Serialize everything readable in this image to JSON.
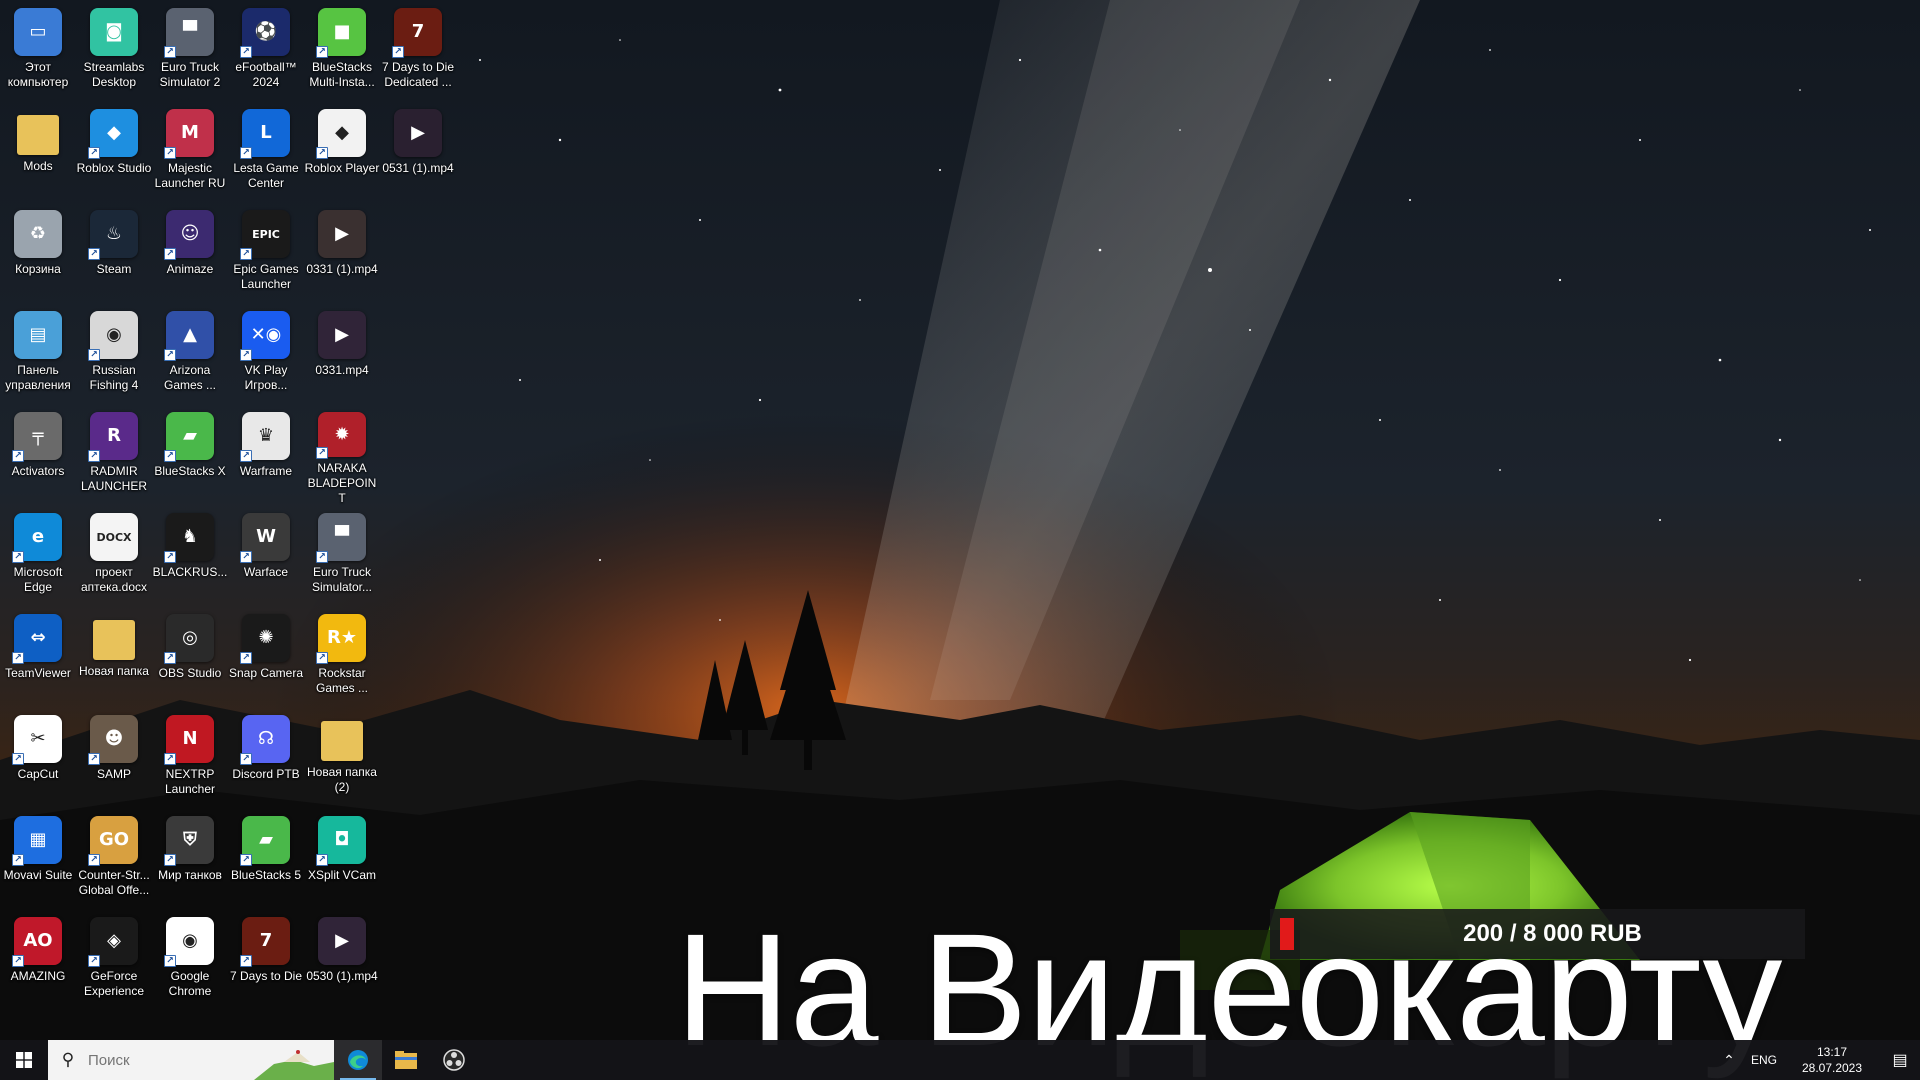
{
  "desktop": {
    "icons": [
      {
        "label": "Этот компьютер",
        "icon": "this-pc-icon",
        "bg": "#3a7bd5",
        "glyph": "▭",
        "shortcut": false
      },
      {
        "label": "Streamlabs Desktop",
        "icon": "streamlabs-icon",
        "bg": "#31c3a2",
        "glyph": "◙",
        "shortcut": false
      },
      {
        "label": "Euro Truck Simulator 2",
        "icon": "euro-truck-icon",
        "bg": "#5a6270",
        "glyph": "▀",
        "shortcut": true
      },
      {
        "label": "eFootball™ 2024",
        "icon": "efootball-icon",
        "bg": "#1b2a6b",
        "glyph": "⚽",
        "shortcut": true
      },
      {
        "label": "BlueStacks Multi-Insta...",
        "icon": "bluestacks-multi-icon",
        "bg": "#57c442",
        "glyph": "■",
        "shortcut": true
      },
      {
        "label": "7 Days to Die Dedicated ...",
        "icon": "7days-dedicated-icon",
        "bg": "#6b1d12",
        "glyph": "7",
        "shortcut": true
      },
      {
        "label": "Mods",
        "icon": "folder-icon",
        "bg": "#e8c25a",
        "glyph": "",
        "shortcut": false
      },
      {
        "label": "Roblox Studio",
        "icon": "roblox-studio-icon",
        "bg": "#1e8fe0",
        "glyph": "◆",
        "shortcut": true
      },
      {
        "label": "Majestic Launcher RU",
        "icon": "majestic-icon",
        "bg": "#c0304a",
        "glyph": "M",
        "shortcut": true
      },
      {
        "label": "Lesta Game Center",
        "icon": "lesta-icon",
        "bg": "#1168d8",
        "glyph": "L",
        "shortcut": true
      },
      {
        "label": "Roblox Player",
        "icon": "roblox-player-icon",
        "bg": "#f2f2f2",
        "glyph": "◆",
        "shortcut": true
      },
      {
        "label": "0531 (1).mp4",
        "icon": "video-file-icon",
        "bg": "#2a2030",
        "glyph": "▶",
        "shortcut": false
      },
      {
        "label": "Корзина",
        "icon": "recycle-bin-icon",
        "bg": "#9aa4ae",
        "glyph": "♻",
        "shortcut": false
      },
      {
        "label": "Steam",
        "icon": "steam-icon",
        "bg": "#1b2838",
        "glyph": "♨",
        "shortcut": true
      },
      {
        "label": "Animaze",
        "icon": "animaze-icon",
        "bg": "#3c2a70",
        "glyph": "☺",
        "shortcut": true
      },
      {
        "label": "Epic Games Launcher",
        "icon": "epic-games-icon",
        "bg": "#1a1a1a",
        "glyph": "EPIC",
        "shortcut": true
      },
      {
        "label": "0331 (1).mp4",
        "icon": "video-file-icon",
        "bg": "#3a3030",
        "glyph": "▶",
        "shortcut": false
      },
      {
        "label": "Панель управления",
        "icon": "control-panel-icon",
        "bg": "#4aa0d8",
        "glyph": "▤",
        "shortcut": false
      },
      {
        "label": "Russian Fishing 4",
        "icon": "russian-fishing-icon",
        "bg": "#d8d8d8",
        "glyph": "◉",
        "shortcut": true
      },
      {
        "label": "Arizona Games ...",
        "icon": "arizona-icon",
        "bg": "#3050a8",
        "glyph": "▲",
        "shortcut": true
      },
      {
        "label": "VK Play Игров...",
        "icon": "vk-play-icon",
        "bg": "#1a5cf0",
        "glyph": "✕◉",
        "shortcut": true
      },
      {
        "label": "0331.mp4",
        "icon": "video-file-icon",
        "bg": "#302438",
        "glyph": "▶",
        "shortcut": false
      },
      {
        "label": "Activators",
        "icon": "activators-icon",
        "bg": "#6a6a6a",
        "glyph": "╤",
        "shortcut": true
      },
      {
        "label": "RADMIR LAUNCHER",
        "icon": "radmir-icon",
        "bg": "#5a2a8a",
        "glyph": "R",
        "shortcut": true
      },
      {
        "label": "BlueStacks X",
        "icon": "bluestacks-x-icon",
        "bg": "#4ab84a",
        "glyph": "▰",
        "shortcut": true
      },
      {
        "label": "Warframe",
        "icon": "warframe-icon",
        "bg": "#e8e8e8",
        "glyph": "♛",
        "shortcut": true
      },
      {
        "label": "NARAKA BLADEPOINT",
        "icon": "naraka-icon",
        "bg": "#b0202a",
        "glyph": "✹",
        "shortcut": true
      },
      {
        "label": "Microsoft Edge",
        "icon": "edge-icon",
        "bg": "#0f8ad8",
        "glyph": "e",
        "shortcut": true
      },
      {
        "label": "проект аптека.docx",
        "icon": "docx-file-icon",
        "bg": "#f4f4f4",
        "glyph": "DOCX",
        "shortcut": false
      },
      {
        "label": "BLACKRUS...",
        "icon": "blackrussia-icon",
        "bg": "#1a1a1a",
        "glyph": "♞",
        "shortcut": true
      },
      {
        "label": "Warface",
        "icon": "warface-icon",
        "bg": "#3a3a3a",
        "glyph": "W",
        "shortcut": true
      },
      {
        "label": "Euro Truck Simulator...",
        "icon": "euro-truck-icon",
        "bg": "#5a6270",
        "glyph": "▀",
        "shortcut": true
      },
      {
        "label": "TeamViewer",
        "icon": "teamviewer-icon",
        "bg": "#0e5fc4",
        "glyph": "⇔",
        "shortcut": true
      },
      {
        "label": "Новая папка",
        "icon": "folder-icon",
        "bg": "#e8c25a",
        "glyph": "",
        "shortcut": false
      },
      {
        "label": "OBS Studio",
        "icon": "obs-icon",
        "bg": "#2a2a2a",
        "glyph": "◎",
        "shortcut": true
      },
      {
        "label": "Snap Camera",
        "icon": "snap-camera-icon",
        "bg": "#1a1a1a",
        "glyph": "✺",
        "shortcut": true
      },
      {
        "label": "Rockstar Games ...",
        "icon": "rockstar-icon",
        "bg": "#f2b90f",
        "glyph": "R★",
        "shortcut": true
      },
      {
        "label": "CapCut",
        "icon": "capcut-icon",
        "bg": "#ffffff",
        "glyph": "✂",
        "shortcut": true
      },
      {
        "label": "SAMP",
        "icon": "samp-icon",
        "bg": "#6a5a4a",
        "glyph": "☻",
        "shortcut": true
      },
      {
        "label": "NEXTRP Launcher",
        "icon": "nextrp-icon",
        "bg": "#c01822",
        "glyph": "N",
        "shortcut": true
      },
      {
        "label": "Discord PTB",
        "icon": "discord-icon",
        "bg": "#5865f2",
        "glyph": "☊",
        "shortcut": true
      },
      {
        "label": "Новая папка (2)",
        "icon": "folder-icon",
        "bg": "#e8c25a",
        "glyph": "",
        "shortcut": false
      },
      {
        "label": "Movavi Suite",
        "icon": "movavi-icon",
        "bg": "#1e6ee0",
        "glyph": "▦",
        "shortcut": true
      },
      {
        "label": "Counter-Str... Global Offe...",
        "icon": "csgo-icon",
        "bg": "#d8a040",
        "glyph": "GO",
        "shortcut": true
      },
      {
        "label": "Мир танков",
        "icon": "mir-tankov-icon",
        "bg": "#3a3a3a",
        "glyph": "⛨",
        "shortcut": true
      },
      {
        "label": "BlueStacks 5",
        "icon": "bluestacks5-icon",
        "bg": "#4ab84a",
        "glyph": "▰",
        "shortcut": true
      },
      {
        "label": "XSplit VCam",
        "icon": "xsplit-vcam-icon",
        "bg": "#16b89c",
        "glyph": "◘",
        "shortcut": true
      },
      {
        "label": "AMAZING",
        "icon": "amazing-icon",
        "bg": "#c0182a",
        "glyph": "AO",
        "shortcut": true
      },
      {
        "label": "GeForce Experience",
        "icon": "geforce-icon",
        "bg": "#1a1a1a",
        "glyph": "◈",
        "shortcut": true
      },
      {
        "label": "Google Chrome",
        "icon": "chrome-icon",
        "bg": "#ffffff",
        "glyph": "◉",
        "shortcut": true
      },
      {
        "label": "7 Days to Die",
        "icon": "7days-icon",
        "bg": "#6b1d12",
        "glyph": "7",
        "shortcut": true
      },
      {
        "label": "0530 (1).mp4",
        "icon": "video-file-icon",
        "bg": "#302438",
        "glyph": "▶",
        "shortcut": false
      }
    ]
  },
  "overlay": {
    "donation_text": "200 / 8 000 RUB",
    "donation_progress": 0.025,
    "caption": "На Видеокарту"
  },
  "taskbar": {
    "search_placeholder": "Поиск",
    "apps": [
      {
        "name": "edge-taskbar-icon",
        "active": true
      },
      {
        "name": "file-explorer-taskbar-icon",
        "active": false
      },
      {
        "name": "obs-taskbar-icon",
        "active": false
      }
    ],
    "tray": {
      "chevron": "^",
      "lang": "ENG",
      "time": "13:17",
      "date": "28.07.2023"
    }
  },
  "colors": {
    "accent": "#76b9ed",
    "donation_fill": "#e11a1a",
    "tent": "#8fd63a",
    "sky_glow": "#e06a1c"
  }
}
